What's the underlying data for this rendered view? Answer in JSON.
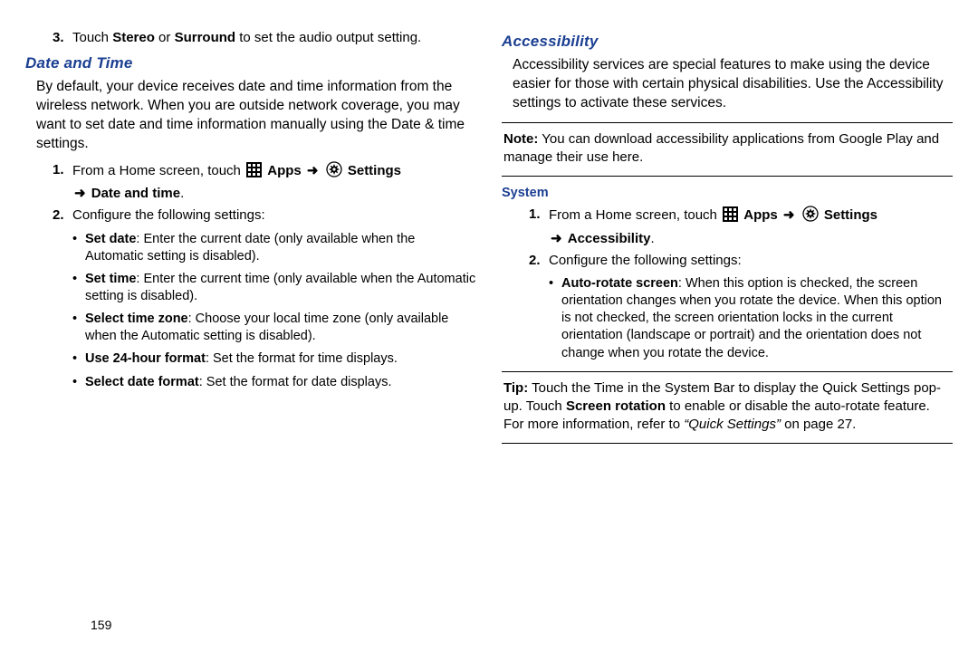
{
  "pageNumber": "159",
  "left": {
    "audioStep": {
      "num": "3.",
      "pre": "Touch ",
      "boldA": "Stereo",
      "mid": " or ",
      "boldB": "Surround",
      "post": " to set the audio output setting."
    },
    "dateHeading": "Date and Time",
    "dateIntro": "By default, your device receives date and time information from the wireless network. When you are outside network coverage, you may want to set date and time information manually using the Date & time settings.",
    "step1": {
      "num": "1.",
      "pre": "From a Home screen, touch ",
      "appsLabel": "Apps",
      "settingsLabel": "Settings",
      "tail": "Date and time",
      "period": "."
    },
    "step2": {
      "num": "2.",
      "text": "Configure the following settings:"
    },
    "bullets": [
      {
        "bold": "Set date",
        "rest": ": Enter the current date (only available when the Automatic setting is disabled)."
      },
      {
        "bold": "Set time",
        "rest": ": Enter the current time (only available when the Automatic setting is disabled)."
      },
      {
        "bold": "Select time zone",
        "rest": ": Choose your local time zone (only available when the Automatic setting is disabled)."
      },
      {
        "bold": "Use 24-hour format",
        "rest": ": Set the format for time displays."
      },
      {
        "bold": "Select date format",
        "rest": ": Set the format for date displays."
      }
    ]
  },
  "right": {
    "accHeading": "Accessibility",
    "accIntro": "Accessibility services are special features to make using the device easier for those with certain physical disabilities. Use the Accessibility settings to activate these services.",
    "note": {
      "label": "Note:",
      "text": " You can download accessibility applications from Google Play and manage their use here."
    },
    "systemHeading": "System",
    "step1": {
      "num": "1.",
      "pre": "From a Home screen, touch ",
      "appsLabel": "Apps",
      "settingsLabel": "Settings",
      "tail": "Accessibility",
      "period": "."
    },
    "step2": {
      "num": "2.",
      "text": "Configure the following settings:"
    },
    "bullet": {
      "bold": "Auto-rotate screen",
      "rest": ": When this option is checked, the screen orientation changes when you rotate the device. When this option is not checked, the screen orientation locks in the current orientation (landscape or portrait) and the orientation does not change when you rotate the device."
    },
    "tip": {
      "label": "Tip:",
      "part1": " Touch the Time in the System Bar to display the Quick Settings pop-up. Touch ",
      "bold": "Screen rotation",
      "part2": " to enable or disable the auto-rotate feature. For more information, refer to ",
      "ital": "“Quick Settings”",
      "part3": " on page 27."
    }
  },
  "glyphs": {
    "arrow": "➜",
    "bullet": "•"
  }
}
